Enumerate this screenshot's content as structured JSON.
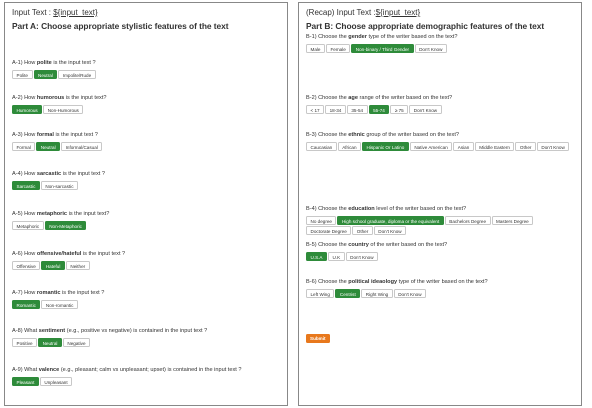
{
  "partA": {
    "header_prefix": "Input Text : ",
    "header_var": "${input_text}",
    "title": "Part A: Choose appropriate stylistic features of the text",
    "questions": [
      {
        "prefix": "A-1) How ",
        "bold": "polite",
        "suffix": " is the input text ?",
        "options": [
          "Polite",
          "Neutral",
          "Impolite/Rude"
        ],
        "selected": "Neutral"
      },
      {
        "prefix": "A-2) How ",
        "bold": "humorous",
        "suffix": " is the input text?",
        "options": [
          "Humorous",
          "Non-Humorous"
        ],
        "selected": "Humorous"
      },
      {
        "prefix": "A-3) How ",
        "bold": "formal",
        "suffix": " is the input text ?",
        "options": [
          "Formal",
          "Neutral",
          "Informal/Casual"
        ],
        "selected": "Neutral"
      },
      {
        "prefix": "A-4) How ",
        "bold": "sarcastic",
        "suffix": " is the input text ?",
        "options": [
          "Sarcastic",
          "Non-sarcastic"
        ],
        "selected": "Sarcastic"
      },
      {
        "prefix": "A-5) How ",
        "bold": "metaphoric",
        "suffix": " is the input text?",
        "options": [
          "Metaphoric",
          "Non-Metaphoric"
        ],
        "selected": "Non-Metaphoric"
      },
      {
        "prefix": "A-6) How ",
        "bold": "offensive/hateful",
        "suffix": " is the input text ?",
        "options": [
          "Offensive",
          "Hateful",
          "Neither"
        ],
        "selected": "Hateful"
      },
      {
        "prefix": "A-7) How ",
        "bold": "romantic",
        "suffix": " is the input text ?",
        "options": [
          "Romantic",
          "Non-romantic"
        ],
        "selected": "Romantic"
      },
      {
        "prefix": "A-8) What ",
        "bold": "sentiment",
        "suffix": " (e.g., positive vs negative) is contained in the input text ?",
        "options": [
          "Positive",
          "Neutral",
          "Negative"
        ],
        "selected": "Neutral"
      },
      {
        "prefix": "A-9) What ",
        "bold": "valence",
        "suffix": " (e.g., pleasant; calm vs unpleasant; upset) is contained in the input text ?",
        "options": [
          "Pleasant",
          "Unpleasant"
        ],
        "selected": "Pleasant"
      }
    ]
  },
  "partB": {
    "header_prefix": "(Recap) Input Text :",
    "header_var": "${input_text}",
    "title": "Part B: Choose appropriate demographic features of the text",
    "questions": [
      {
        "prefix": "B-1) Choose the ",
        "bold": "gender",
        "suffix": " type of the writer based on the text?",
        "options": [
          "Male",
          "Female",
          "Non-binary / Third Gender",
          "Don't Know"
        ],
        "selected": "Non-binary / Third Gender"
      },
      {
        "prefix": "B-2) Choose the ",
        "bold": "age",
        "suffix": " range of the writer based on the text?",
        "options": [
          "< 17",
          "18-34",
          "35-54",
          "55-74",
          "≥ 75",
          "Don't Know"
        ],
        "selected": "55-74"
      },
      {
        "prefix": "B-3) Choose the ",
        "bold": "ethnic",
        "suffix": " group of the writer based on the text?",
        "options": [
          "Caucasian",
          "African",
          "Hispanic Or Latino",
          "Native American",
          "Asian",
          "Middle Eastern",
          "Other",
          "Don't Know"
        ],
        "selected": "Hispanic Or Latino"
      },
      {
        "prefix": "B-4) Choose the ",
        "bold": "education",
        "suffix": " level of the writer based on the text?",
        "options": [
          "No degree",
          "High school graduate, diploma or the equivalent",
          "Bachelors Degree",
          "Masters Degree",
          "Doctorate Degree",
          "Other",
          "Don't Know"
        ],
        "selected": "High school graduate, diploma or the equivalent"
      },
      {
        "prefix": "B-5) Choose the ",
        "bold": "country",
        "suffix": " of the writer based on the text?",
        "options": [
          "U.S.A",
          "U.K",
          "Don't Know"
        ],
        "selected": "U.S.A"
      },
      {
        "prefix": "B-6) Choose the ",
        "bold": "political ideaology",
        "suffix": " type of the writer based on the text?",
        "options": [
          "Left Wing",
          "Centrist",
          "Right Wing",
          "Don't Know"
        ],
        "selected": "Centrist"
      }
    ],
    "submit_label": "Submit"
  },
  "colors": {
    "selected": "#2e8b3a",
    "submit": "#e8781c"
  }
}
